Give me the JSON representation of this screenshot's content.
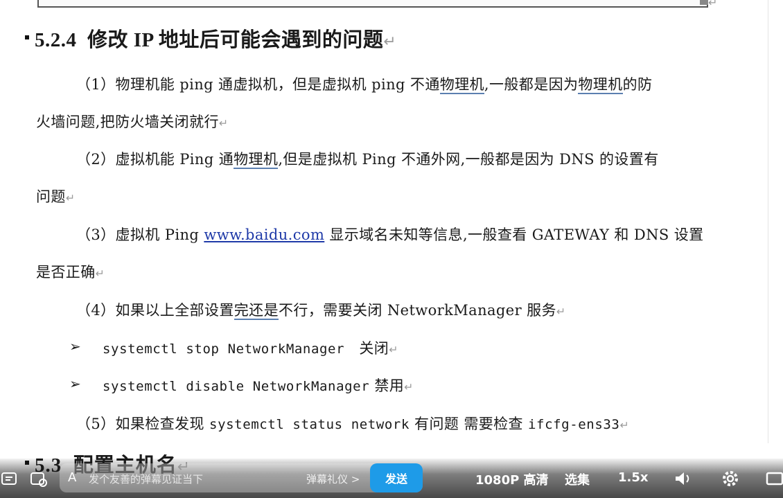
{
  "section_heading": {
    "number": "5.2.4",
    "title": "修改 IP 地址后可能会遇到的问题"
  },
  "paragraphs": {
    "p1_line1_a": "（1）物理机能 ping 通虚拟机，但是虚拟机 ping 不通",
    "p1_line1_u1": "物理机",
    "p1_line1_b": ",一般都是因为",
    "p1_line1_u2": "物理机",
    "p1_line1_c": "的防",
    "p1_line2": "火墙问题,把防火墙关闭就行",
    "p2_line1_a": "（2）虚拟机能 Ping 通",
    "p2_line1_u": "物理机",
    "p2_line1_b": ",但是虚拟机 Ping 不通外网,一般都是因为 DNS 的设置有",
    "p2_line2": "问题",
    "p3_line1_a": "（3）虚拟机 Ping ",
    "p3_line1_link": "www.baidu.com",
    "p3_line1_b": " 显示域名未知等信息,一般查看 GATEWAY 和 DNS 设置",
    "p3_line2": "是否正确",
    "p4_a": "（4）如果以上全部设置",
    "p4_u": "完还是",
    "p4_b": "不行，需要关闭 NetworkManager 服务"
  },
  "bullets": [
    {
      "cmd": "systemctl stop NetworkManager",
      "note": "关闭"
    },
    {
      "cmd": "systemctl disable NetworkManager",
      "note": "禁用"
    }
  ],
  "p5": {
    "a": "（5）如果检查发现 ",
    "cmd1": "systemctl status network",
    "b": " 有问题 需要检查 ",
    "cmd2": "ifcfg-ens33"
  },
  "next_heading": {
    "number": "5.3",
    "title": "配置主机名"
  },
  "return_mark": "↵",
  "bullet_glyph": "➢",
  "player": {
    "danmu_placeholder": "发个友善的弹幕见证当下",
    "danmu_gift": "弹幕礼仪 >",
    "send_label": "发送",
    "quality": "1080P 高清",
    "episodes": "选集",
    "speed": "1.5x",
    "icons": [
      "danmu-toggle-icon",
      "danmu-settings-icon",
      "volume-icon",
      "settings-icon",
      "widescreen-icon"
    ]
  },
  "colors": {
    "link": "#1f3aa8",
    "send_button": "#1e9be8",
    "underline": "#5b7fb0"
  }
}
